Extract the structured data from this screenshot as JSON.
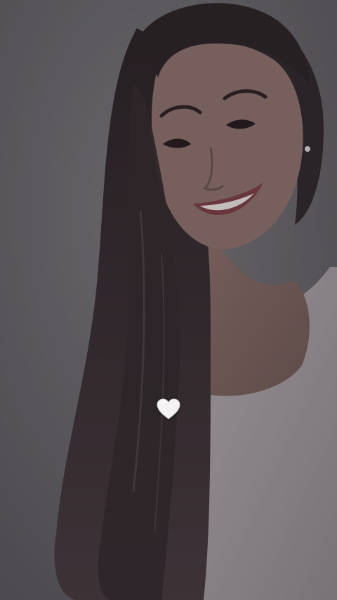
{
  "story": {
    "background_color": "#5e5c5f",
    "sticker": {
      "icon": "white-heart-icon",
      "color": "#f4f2f3"
    }
  }
}
